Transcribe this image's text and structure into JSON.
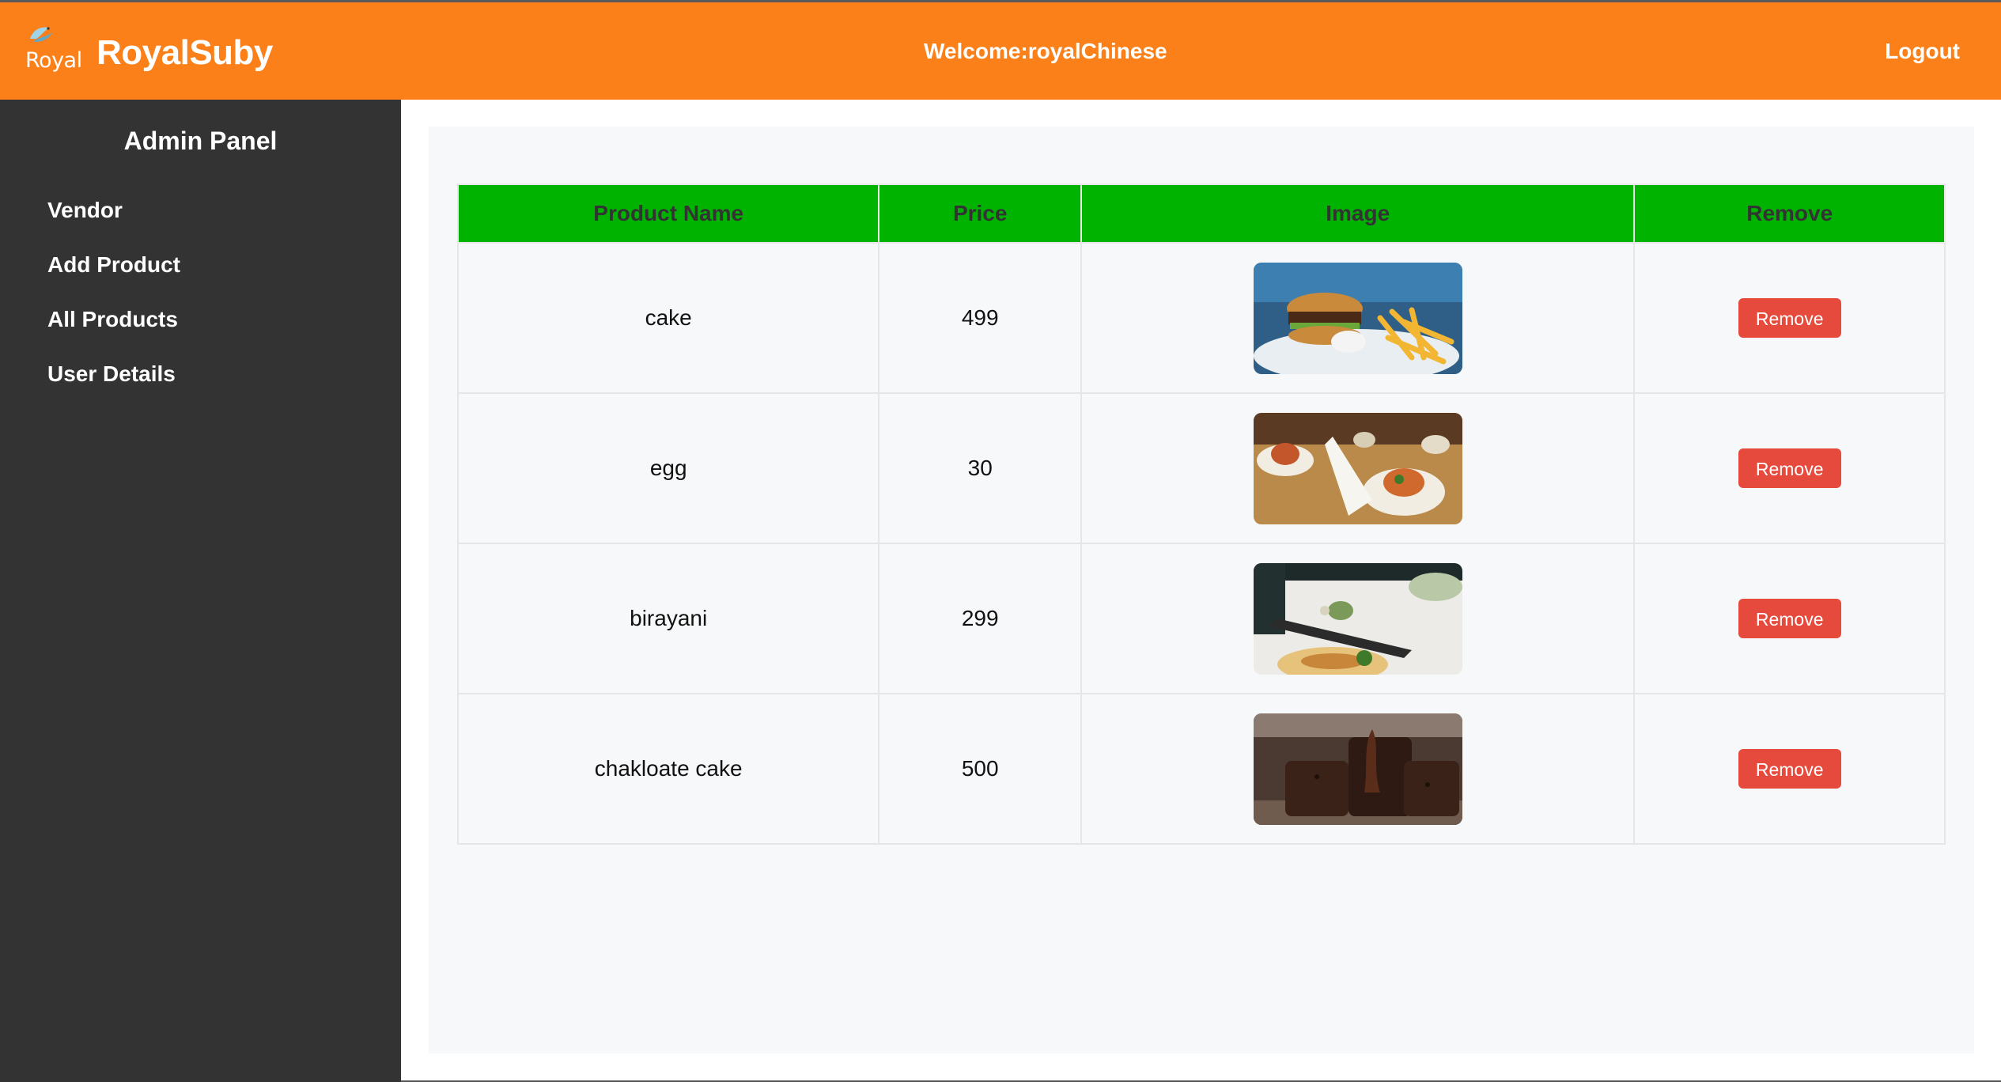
{
  "header": {
    "logo_text": "Royal",
    "brand_name": "RoyalSuby",
    "welcome_text": "Welcome:royalChinese",
    "logout_label": "Logout",
    "background_color": "#fc8019"
  },
  "sidebar": {
    "title": "Admin Panel",
    "items": [
      {
        "label": "Vendor"
      },
      {
        "label": "Add Product"
      },
      {
        "label": "All Products"
      },
      {
        "label": "User Details"
      }
    ],
    "background_color": "#333333"
  },
  "table": {
    "headers": {
      "name": "Product Name",
      "price": "Price",
      "image": "Image",
      "remove": "Remove"
    },
    "header_color": "#00b300",
    "rows": [
      {
        "name": "cake",
        "price": "499",
        "image": "burger-and-fries-photo",
        "remove_label": "Remove"
      },
      {
        "name": "egg",
        "price": "30",
        "image": "dining-table-photo",
        "remove_label": "Remove"
      },
      {
        "name": "birayani",
        "price": "299",
        "image": "pizza-table-photo",
        "remove_label": "Remove"
      },
      {
        "name": "chakloate cake",
        "price": "500",
        "image": "chocolate-brownie-photo",
        "remove_label": "Remove"
      }
    ],
    "remove_button_color": "#e64a3c"
  }
}
